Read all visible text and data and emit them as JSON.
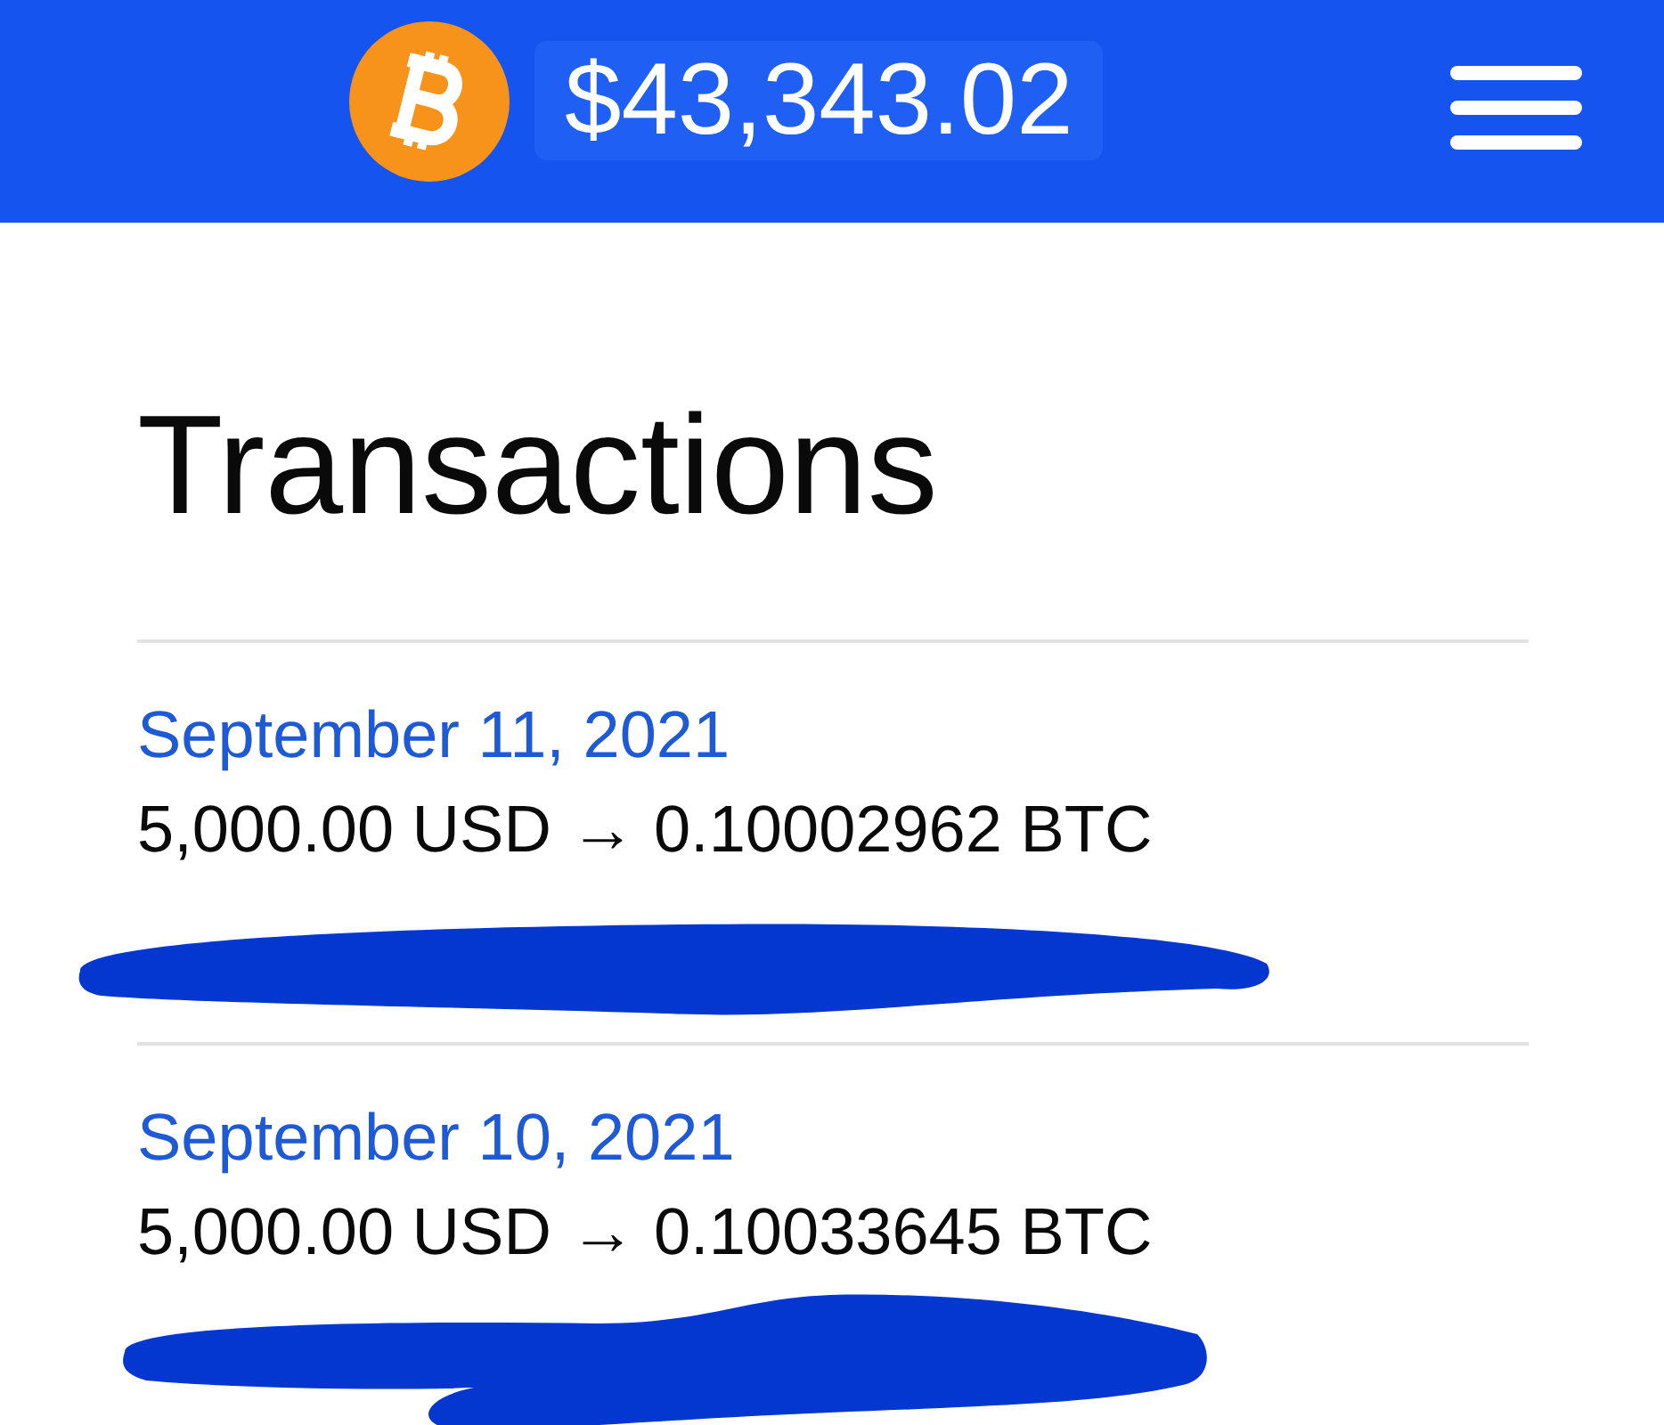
{
  "header": {
    "price": "$43,343.02"
  },
  "title": "Transactions",
  "transactions": [
    {
      "date": "September 11, 2021",
      "amount": "5,000.00 USD → 0.10002962 BTC",
      "address_redacted": true
    },
    {
      "date": "September 10, 2021",
      "amount": "5,000.00 USD → 0.10033645 BTC",
      "address_redacted": true
    }
  ]
}
